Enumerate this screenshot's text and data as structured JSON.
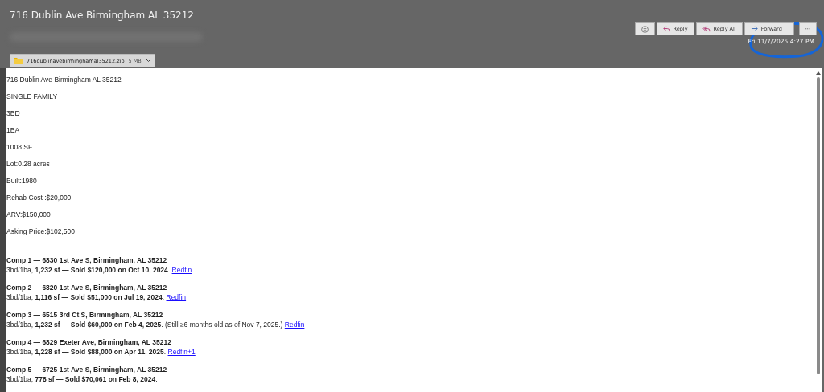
{
  "subject": "716 Dublin Ave Birmingham AL 35212",
  "attachment": {
    "name": "716dublinavebirminghamal35212.zip",
    "size": "5 MB"
  },
  "actions": [
    {
      "kind": "emoji"
    },
    {
      "kind": "reply",
      "label": "Reply"
    },
    {
      "kind": "reply_all",
      "label": "Reply All"
    },
    {
      "kind": "forward",
      "label": "Forward"
    },
    {
      "kind": "more",
      "label": "···"
    }
  ],
  "date": "Fri 11/7/2025 4:27 PM",
  "facts": [
    "716 Dublin Ave Birmingham AL 35212",
    "SINGLE FAMILY",
    "3BD",
    "1BA",
    "1008 SF",
    "Lot:0.28 acres",
    "Built:1980",
    "Rehab Cost :$20,000",
    "ARV:$150,000",
    "Asking Price:$102,500"
  ],
  "comps": [
    {
      "heading": "Comp 1 — 6830 1st Ave S, Birmingham, AL 35212",
      "detail": "3bd/1ba, **1,232 sf — Sold $120,000 on Oct 10, 2024**.",
      "link": "Redfin"
    },
    {
      "heading": "Comp 2 — 6820 1st Ave S, Birmingham, AL 35212",
      "detail": "3bd/1ba, **1,116 sf — Sold $51,000 on Jul 19, 2024**.",
      "link": "Redfin"
    },
    {
      "heading": "Comp 3 — 6515 3rd Ct S, Birmingham, AL 35212",
      "detail": "3bd/1ba, **1,232 sf — Sold $60,000 on Feb 4, 2025**. (Still ≥6 months old as of Nov 7, 2025.)",
      "link": "Redfin"
    },
    {
      "heading": "Comp 4 — 6829 Exeter Ave, Birmingham, AL 35212",
      "detail": "3bd/1ba, **1,228 sf — Sold $88,000 on Apr 11, 2025**.",
      "link": "Redfin+1"
    },
    {
      "heading": "Comp 5 — 6725 1st Ave S, Birmingham, AL 35212",
      "detail": "3bd/1ba, **778 sf — Sold $70,061 on Feb 8, 2024**."
    }
  ]
}
